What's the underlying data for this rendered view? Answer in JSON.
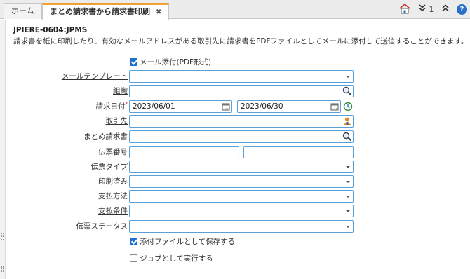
{
  "tabs": {
    "home": "ホーム",
    "active": "まとめ請求書から請求書印刷",
    "close": "✖"
  },
  "toolbar": {
    "tab_count": "1",
    "help": "?"
  },
  "page": {
    "id": "JPIERE-0604:JPMS",
    "description": "請求書を紙に印刷したり、有効なメールアドレスがある取引先に請求書をPDFファイルとしてメールに添付して送信することができます。"
  },
  "form": {
    "mail_attach": {
      "label": "メール添付(PDF形式)",
      "checked": true
    },
    "mail_template": {
      "label": "メールテンプレート",
      "value": ""
    },
    "organization": {
      "label": "組織",
      "value": ""
    },
    "invoice_date": {
      "label": "請求日付",
      "required_mark": "*",
      "from": "2023/06/01",
      "to": "2023/06/30"
    },
    "business_partner": {
      "label": "取引先",
      "value": ""
    },
    "summary_invoice": {
      "label": "まとめ請求書",
      "value": ""
    },
    "document_no": {
      "label": "伝票番号",
      "from": "",
      "to": ""
    },
    "document_type": {
      "label": "伝票タイプ",
      "value": ""
    },
    "printed": {
      "label": "印刷済み",
      "value": ""
    },
    "payment_method": {
      "label": "支払方法",
      "value": ""
    },
    "payment_term": {
      "label": "支払条件",
      "value": ""
    },
    "doc_status": {
      "label": "伝票ステータス",
      "value": ""
    },
    "save_attachment": {
      "label": "添付ファイルとして保存する",
      "checked": true
    },
    "run_as_job": {
      "label": "ジョブとして実行する",
      "checked": false
    }
  },
  "colors": {
    "accent": "#f0a030",
    "field_border": "#5aa0d8",
    "checkbox": "#1f6fd1"
  }
}
